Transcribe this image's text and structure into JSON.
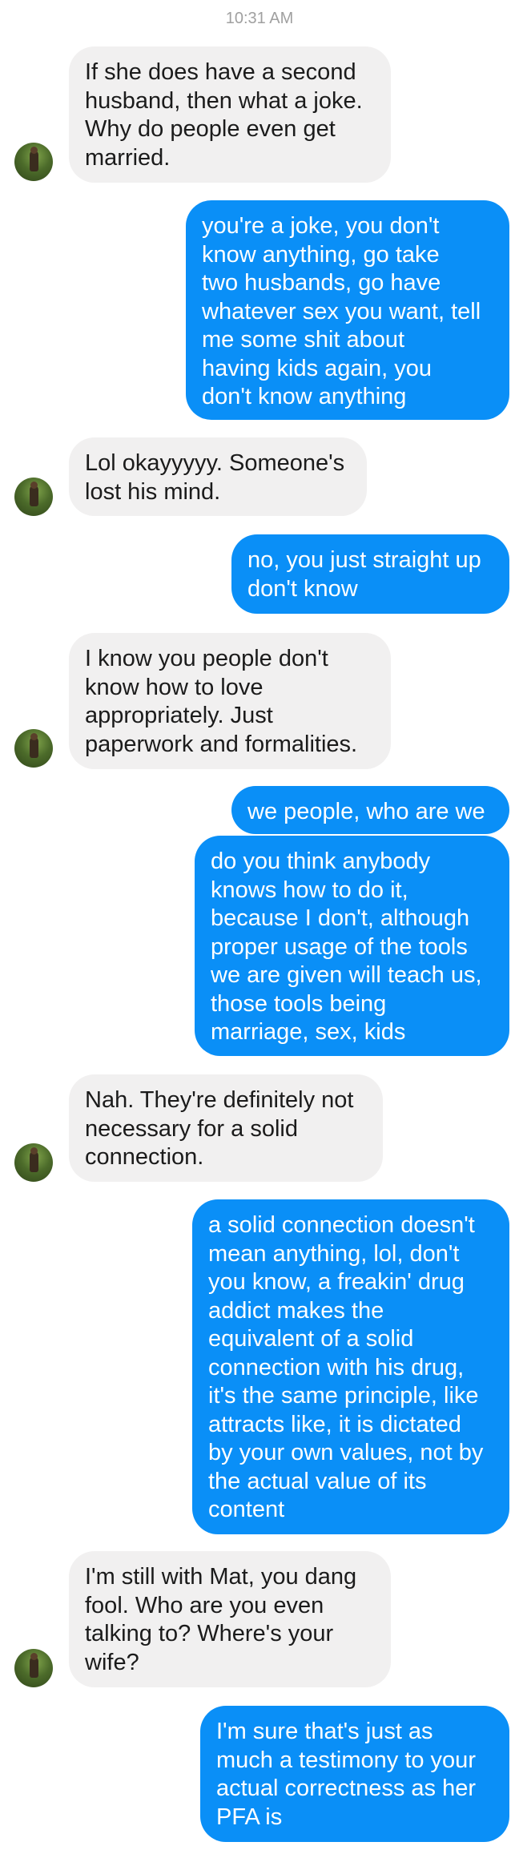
{
  "header": {
    "timestamp": "10:31 AM"
  },
  "contact": {
    "avatar_icon": "contact-avatar-photo"
  },
  "colors": {
    "incoming_bubble": "#f1f0f0",
    "outgoing_bubble": "#0a8ff7",
    "timestamp": "#a0a0a0"
  },
  "messages": [
    {
      "direction": "incoming",
      "lines": [
        "If she does have a second",
        "husband, then what a joke.",
        "Why do people even get",
        "married."
      ]
    },
    {
      "direction": "outgoing",
      "lines": [
        "you're a joke, you don't",
        "know anything, go take",
        "two husbands, go have",
        "whatever sex you want, tell",
        "me some shit about",
        "having kids again, you",
        "don't know anything"
      ]
    },
    {
      "direction": "incoming",
      "lines": [
        "Lol okayyyyy. Someone's",
        "lost his mind."
      ]
    },
    {
      "direction": "outgoing",
      "lines": [
        "no, you just straight up",
        "don't know"
      ]
    },
    {
      "direction": "incoming",
      "lines": [
        "I know you people don't",
        "know how to love",
        "appropriately. Just",
        "paperwork and formalities."
      ]
    },
    {
      "direction": "outgoing",
      "lines": [
        "we people, who are we"
      ]
    },
    {
      "direction": "outgoing",
      "lines": [
        "do you think anybody",
        "knows how to do it,",
        "because I don't, although",
        "proper usage of the tools",
        "we are given will teach us,",
        "those tools being",
        "marriage, sex, kids"
      ]
    },
    {
      "direction": "incoming",
      "lines": [
        "Nah. They're definitely not",
        "necessary for a solid",
        "connection."
      ]
    },
    {
      "direction": "outgoing",
      "lines": [
        "a solid connection doesn't",
        "mean anything, lol, don't",
        "you know, a freakin' drug",
        "addict makes the",
        "equivalent of a solid",
        "connection with his drug,",
        "it's the same principle, like",
        "attracts like, it is dictated",
        "by your own values, not by",
        "the actual value of its",
        "content"
      ]
    },
    {
      "direction": "incoming",
      "lines": [
        "I'm still with Mat, you dang",
        "fool. Who are you even",
        "talking to? Where's your",
        "wife?"
      ]
    },
    {
      "direction": "outgoing",
      "lines": [
        "I'm sure that's just as",
        "much a testimony to your",
        "actual correctness as her",
        "PFA is"
      ]
    }
  ]
}
